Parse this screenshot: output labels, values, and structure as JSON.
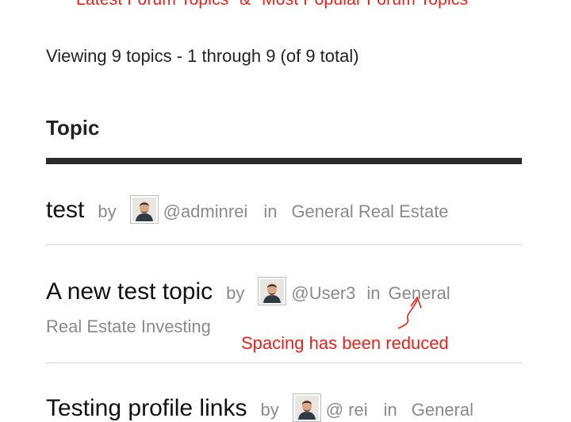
{
  "annotations": {
    "top": "Latest Forum Topics\" & \"Most Popular Forum Topics",
    "spacing_note": "Spacing has been reduced",
    "color": "#e8231c"
  },
  "viewing": "Viewing 9 topics - 1 through 9 (of 9 total)",
  "table": {
    "column_header": "Topic"
  },
  "topics": [
    {
      "title": "test",
      "by": "by",
      "user": "@adminrei",
      "in": "in",
      "forum": "General Real Estate"
    },
    {
      "title": "A new test topic",
      "by": "by",
      "user": "@User3",
      "in": "in",
      "forum_line1": "General",
      "forum_line2": "Real Estate Investing"
    },
    {
      "title": "Testing profile links",
      "by": "by",
      "user": "@ rei",
      "in": "in",
      "forum": "General"
    }
  ],
  "icons": {
    "avatar": "avatar-icon",
    "arrow": "annotation-arrow-icon"
  }
}
